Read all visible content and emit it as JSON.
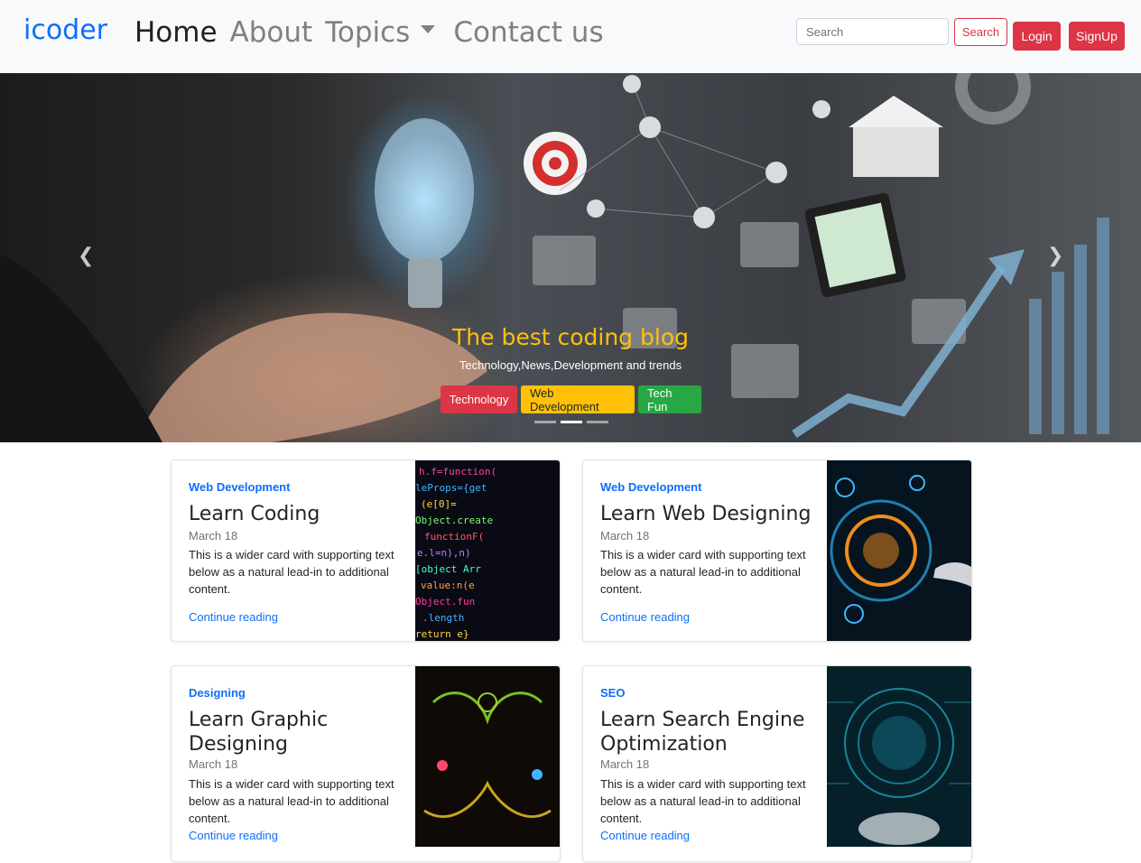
{
  "navbar": {
    "brand": "icoder",
    "links": [
      "Home",
      "About",
      "Topics",
      "Contact us"
    ],
    "search_placeholder": "Search",
    "search_button": "Search",
    "login_button": "Login",
    "signup_button": "SignUp"
  },
  "carousel": {
    "title": "The best coding blog",
    "subtitle": "Technology,News,Development and trends",
    "buttons": [
      "Technology",
      "Web Development",
      "Tech Fun"
    ],
    "slide_count": 3,
    "active_slide": 2
  },
  "cards": [
    {
      "category": "Web Development",
      "title": "Learn Coding",
      "date": "March 18",
      "text": "This is a wider card with supporting text below as a natural lead-in to additional content.",
      "link": "Continue reading"
    },
    {
      "category": "Web Development",
      "title": "Learn Web Designing",
      "date": "March 18",
      "text": "This is a wider card with supporting text below as a natural lead-in to additional content.",
      "link": "Continue reading"
    },
    {
      "category": "Designing",
      "title": "Learn Graphic Designing",
      "date": "March 18",
      "text": "This is a wider card with supporting text below as a natural lead-in to additional content.",
      "link": "Continue reading"
    },
    {
      "category": "SEO",
      "title": "Learn Search Engine Optimization",
      "date": "March 18",
      "text": "This is a wider card with supporting text below as a natural lead-in to additional content.",
      "link": "Continue reading"
    }
  ],
  "colors": {
    "brand": "#0d6efd",
    "danger": "#dc3545",
    "warning": "#ffc107",
    "success": "#28a745",
    "link": "#0d6efd"
  }
}
